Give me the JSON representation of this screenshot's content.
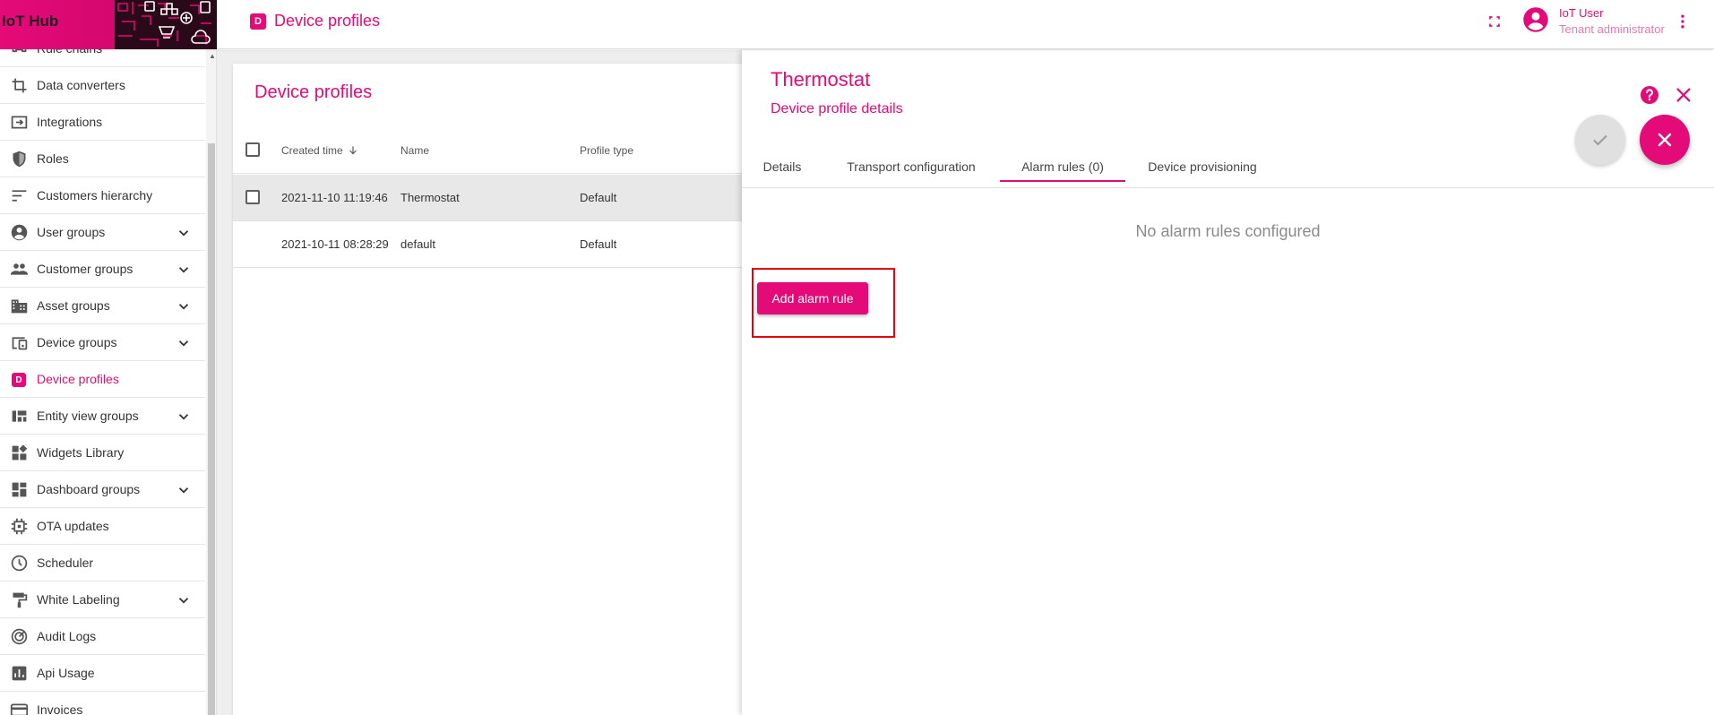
{
  "app": {
    "logo_text": "IoT Hub"
  },
  "header": {
    "badge_letter": "D",
    "title": "Device profiles",
    "user_name": "IoT User",
    "user_role": "Tenant administrator"
  },
  "sidebar": {
    "partial_item_label": "Rule chains",
    "items": [
      {
        "label": "Data converters",
        "icon": "data-converters-icon",
        "expandable": false
      },
      {
        "label": "Integrations",
        "icon": "integrations-icon",
        "expandable": false
      },
      {
        "label": "Roles",
        "icon": "shield-icon",
        "expandable": false
      },
      {
        "label": "Customers hierarchy",
        "icon": "sort-icon",
        "expandable": false
      },
      {
        "label": "User groups",
        "icon": "account-circle-icon",
        "expandable": true
      },
      {
        "label": "Customer groups",
        "icon": "people-icon",
        "expandable": true
      },
      {
        "label": "Asset groups",
        "icon": "domain-icon",
        "expandable": true
      },
      {
        "label": "Device groups",
        "icon": "devices-icon",
        "expandable": true
      },
      {
        "label": "Device profiles",
        "icon": "device-profile-icon",
        "expandable": false,
        "active": true,
        "badge": "D"
      },
      {
        "label": "Entity view groups",
        "icon": "view-quilt-icon",
        "expandable": true
      },
      {
        "label": "Widgets Library",
        "icon": "widgets-icon",
        "expandable": false
      },
      {
        "label": "Dashboard groups",
        "icon": "dashboard-icon",
        "expandable": true
      },
      {
        "label": "OTA updates",
        "icon": "memory-icon",
        "expandable": false
      },
      {
        "label": "Scheduler",
        "icon": "clock-icon",
        "expandable": false
      },
      {
        "label": "White Labeling",
        "icon": "format-paint-icon",
        "expandable": true
      },
      {
        "label": "Audit Logs",
        "icon": "track-changes-icon",
        "expandable": false
      },
      {
        "label": "Api Usage",
        "icon": "insert-chart-icon",
        "expandable": false
      },
      {
        "label": "Invoices",
        "icon": "credit-card-icon",
        "expandable": false
      }
    ]
  },
  "list": {
    "title": "Device profiles",
    "columns": {
      "created_time": "Created time",
      "name": "Name",
      "profile_type": "Profile type"
    },
    "rows": [
      {
        "created_time": "2021-11-10 11:19:46",
        "name": "Thermostat",
        "profile_type": "Default",
        "selected": true
      },
      {
        "created_time": "2021-10-11 08:28:29",
        "name": "default",
        "profile_type": "Default",
        "selected": false
      }
    ]
  },
  "details": {
    "title": "Thermostat",
    "subtitle": "Device profile details",
    "tabs": [
      {
        "label": "Details"
      },
      {
        "label": "Transport configuration"
      },
      {
        "label": "Alarm rules (0)",
        "active": true
      },
      {
        "label": "Device provisioning"
      }
    ],
    "empty_message": "No alarm rules configured",
    "add_button_label": "Add alarm rule"
  },
  "colors": {
    "accent": "#e40a77",
    "highlight": "#e8000b"
  }
}
